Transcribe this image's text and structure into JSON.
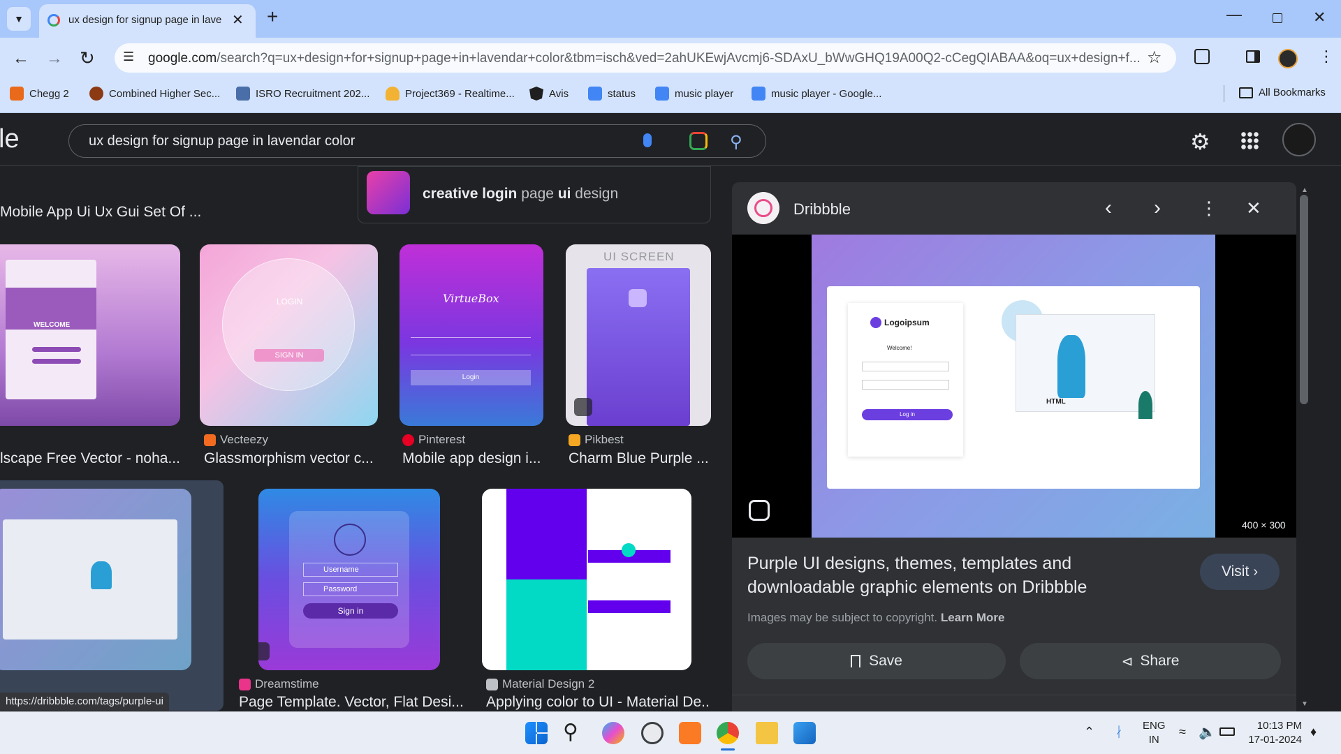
{
  "browser": {
    "tab_title": "ux design for signup page in laven",
    "url_domain": "google.com",
    "url_rest": "/search?q=ux+design+for+signup+page+in+lavendar+color&tbm=isch&ved=2ahUKEwjAvcmj6-SDAxU_bWwGHQ19A00Q2-cCegQIABAA&oq=ux+design+f...",
    "bookmarks": [
      {
        "label": "Chegg 2",
        "color": "#ea6a1c"
      },
      {
        "label": "Combined Higher Sec...",
        "color": "#8b3a14"
      },
      {
        "label": "ISRO Recruitment 202...",
        "color": "#4a6ea8"
      },
      {
        "label": "Project369 - Realtime...",
        "color": "#f2b233"
      },
      {
        "label": "Avis",
        "color": "#1f1f1f"
      },
      {
        "label": "status",
        "color": "#4285f4"
      },
      {
        "label": "music player",
        "color": "#4285f4"
      },
      {
        "label": "music player - Google...",
        "color": "#4285f4"
      }
    ],
    "all_bookmarks": "All Bookmarks"
  },
  "google": {
    "logo_fragment": "le",
    "query": "ux design for signup page in lavendar color"
  },
  "results": {
    "top_left_title": "Mobile App Ui Ux Gui Set Of ...",
    "related": {
      "bold1": "creative login",
      "plain1": " page ",
      "bold2": "ui",
      "plain2": " design"
    },
    "row1": [
      {
        "source": "",
        "title": "lscape Free Vector - noha..."
      },
      {
        "source": "Vecteezy",
        "title": "Glassmorphism vector c...",
        "fav": "#f26b21"
      },
      {
        "source": "Pinterest",
        "title": "Mobile app design i...",
        "fav": "#e60023"
      },
      {
        "source": "Pikbest",
        "title": "Charm Blue Purple ...",
        "fav": "#f5a623"
      }
    ],
    "row2": [
      {
        "source": "Dreamstime",
        "title": "Page Template. Vector, Flat Desi...",
        "fav": "#e9348a"
      },
      {
        "source": "Material Design 2",
        "title": "Applying color to UI - Material De...",
        "fav": "#bdc1c6"
      }
    ],
    "img_texts": {
      "welcome": "WELCOME",
      "login": "LOGIN",
      "sign_in_caps": "SIGN IN",
      "virtuebox": "VirtueBox",
      "virtue_login": "Login",
      "ui_screen": "UI SCREEN",
      "username": "Username",
      "password": "Password",
      "sign_in": "Sign in"
    },
    "status_url": "https://dribbble.com/tags/purple-ui"
  },
  "panel": {
    "site": "Dribbble",
    "dimensions": "400 × 300",
    "logo_text": "Logoipsum",
    "welcome": "Welcome!",
    "login_btn": "Log in",
    "html_label": "HTML",
    "title_line1": "Purple UI designs, themes, templates and",
    "title_line2": "downloadable graphic elements on Dribbble",
    "copyright": "Images may be subject to copyright.",
    "learn_more": "Learn More",
    "visit": "Visit",
    "save": "Save",
    "share": "Share"
  },
  "taskbar": {
    "lang1": "ENG",
    "lang2": "IN",
    "time": "10:13 PM",
    "date": "17-01-2024"
  }
}
